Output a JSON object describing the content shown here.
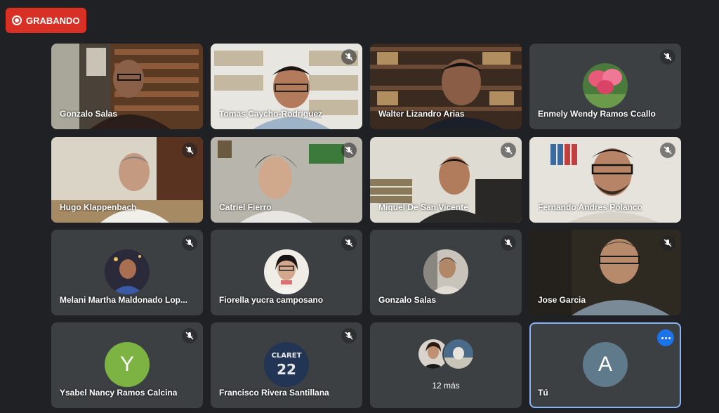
{
  "recording": {
    "label": "GRABANDO",
    "color": "#d93025"
  },
  "tiles": [
    {
      "name": "Gonzalo Salas",
      "type": "video",
      "muted": false
    },
    {
      "name": "Tomas Caycho-Rodriguez",
      "type": "video",
      "muted": true
    },
    {
      "name": "Walter Lizandro Arias",
      "type": "video",
      "muted": false
    },
    {
      "name": "Enmely Wendy Ramos Ccallo",
      "type": "avatar-photo",
      "muted": true
    },
    {
      "name": "Hugo Klappenbach",
      "type": "video",
      "muted": true
    },
    {
      "name": "Catriel Fierro",
      "type": "video",
      "muted": true
    },
    {
      "name": "Miguel De San Vicente",
      "type": "video",
      "muted": true
    },
    {
      "name": "Fernando Andres Polanco",
      "type": "video",
      "muted": true
    },
    {
      "name": "Melani Martha Maldonado Lop...",
      "type": "avatar-photo",
      "muted": true
    },
    {
      "name": "Fiorella yucra camposano",
      "type": "avatar-photo",
      "muted": true
    },
    {
      "name": "Gonzalo Salas",
      "type": "avatar-photo",
      "muted": true
    },
    {
      "name": "Jose Garcia",
      "type": "video",
      "muted": true
    },
    {
      "name": "Ysabel Nancy Ramos Calcina",
      "type": "avatar-letter",
      "letter": "Y",
      "avatar_color": "#7cb342",
      "muted": true
    },
    {
      "name": "Francisco Rivera Santillana",
      "type": "avatar-photo",
      "jersey_text": "CLARET",
      "jersey_number": "22",
      "muted": true
    },
    {
      "name": "",
      "type": "more",
      "more_label": "12 más"
    },
    {
      "name": "Tú",
      "type": "self",
      "letter": "A",
      "avatar_color": "#5f7a8a"
    }
  ],
  "colors": {
    "background": "#202124",
    "tile": "#3c4043",
    "self_border": "#8ab4f8",
    "options_button": "#1a73e8"
  }
}
